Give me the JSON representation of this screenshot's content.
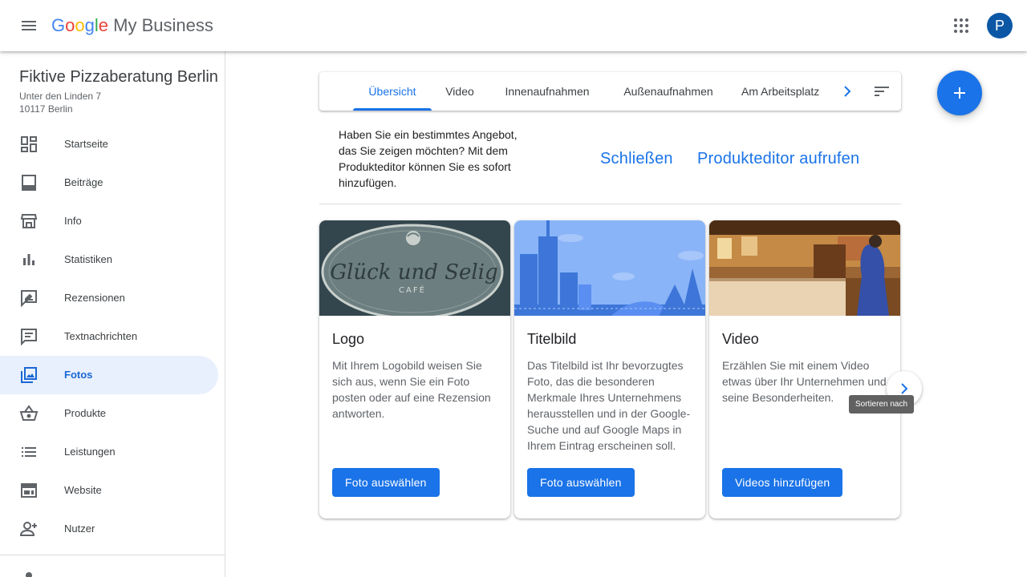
{
  "header": {
    "brand": {
      "g1": "G",
      "g2": "o",
      "g3": "o",
      "g4": "g",
      "g5": "l",
      "g6": "e",
      "product": " My Business"
    },
    "avatar_initial": "P",
    "icons": {
      "menu": "hamburger-icon",
      "apps": "apps-grid-icon"
    }
  },
  "sidebar": {
    "business_name": "Fiktive Pizzaberatung Berlin",
    "address_line1": "Unter den Linden 7",
    "address_line2": "10117 Berlin",
    "items": [
      {
        "label": "Startseite",
        "icon": "dashboard-icon"
      },
      {
        "label": "Beiträge",
        "icon": "posts-icon"
      },
      {
        "label": "Info",
        "icon": "storefront-icon"
      },
      {
        "label": "Statistiken",
        "icon": "bar-chart-icon"
      },
      {
        "label": "Rezensionen",
        "icon": "rate-review-icon"
      },
      {
        "label": "Textnachrichten",
        "icon": "message-icon"
      },
      {
        "label": "Fotos",
        "icon": "photo-library-icon",
        "active": true
      },
      {
        "label": "Produkte",
        "icon": "basket-icon"
      },
      {
        "label": "Leistungen",
        "icon": "list-icon"
      },
      {
        "label": "Website",
        "icon": "web-icon"
      },
      {
        "label": "Nutzer",
        "icon": "person-add-icon"
      }
    ]
  },
  "tabs": [
    {
      "label": "Übersicht",
      "active": true
    },
    {
      "label": "Video"
    },
    {
      "label": "Innenaufnahmen"
    },
    {
      "label": "Außenaufnahmen"
    },
    {
      "label": "Am Arbeitsplatz"
    }
  ],
  "promo": {
    "text": "Haben Sie ein bestimmtes Angebot, das Sie zeigen möchten? Mit dem Produkteditor können Sie es sofort hinzufügen.",
    "close_label": "Schließen",
    "open_label": "Produkteditor aufrufen"
  },
  "cards": [
    {
      "title": "Logo",
      "description": "Mit Ihrem Logobild weisen Sie sich aus, wenn Sie ein Foto posten oder auf eine Rezension antworten.",
      "button": "Foto auswählen",
      "logo_text": "Glück und Selig",
      "logo_sub": "CAFÉ"
    },
    {
      "title": "Titelbild",
      "description": "Das Titelbild ist Ihr bevorzugtes Foto, das die besonderen Merkmale Ihres Unternehmens herausstellen und in der Google-Suche und auf Google Maps in Ihrem Eintrag erscheinen soll.",
      "button": "Foto auswählen"
    },
    {
      "title": "Video",
      "description": "Erzählen Sie mit einem Video etwas über Ihr Unternehmen und seine Besonderheiten.",
      "button": "Videos hinzufügen"
    }
  ],
  "tooltip": "Sortieren nach",
  "colors": {
    "accent": "#1a73e8",
    "active_bg": "#e8f0fe",
    "avatar": "#0b57a5"
  }
}
